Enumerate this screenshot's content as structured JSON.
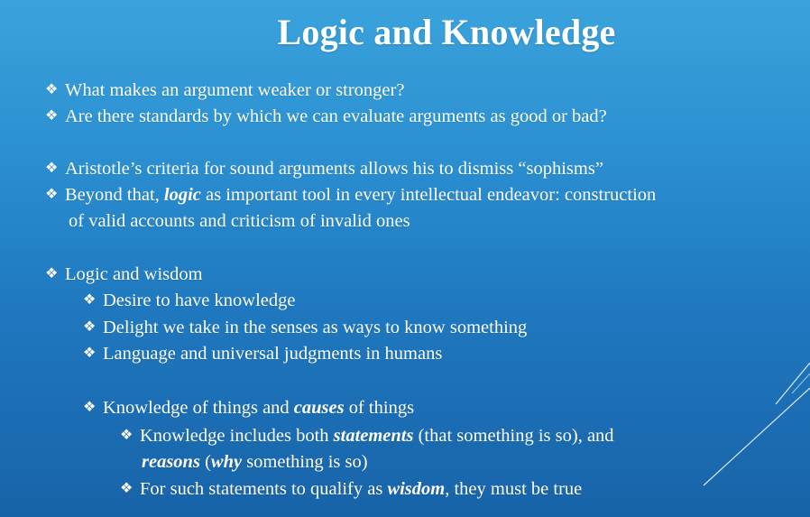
{
  "slide": {
    "title": "Logic and Knowledge",
    "marker": "❖",
    "colors": {
      "background_top": "#3aa3dc",
      "background_bottom": "#1863a8",
      "text": "#ffffff"
    },
    "bullets": {
      "q1": "What makes an argument weaker or stronger?",
      "q2": "Are there standards by which we can evaluate arguments as good or bad?",
      "aristotle": "Aristotle’s criteria for sound arguments allows his to dismiss “sophisms”",
      "beyond_pre": "Beyond that, ",
      "beyond_em": "logic",
      "beyond_post": " as important tool in every intellectual endeavor: construction",
      "beyond_cont": "of valid accounts and criticism of invalid ones",
      "logic_wisdom": "Logic and wisdom",
      "desire": "Desire to have knowledge",
      "delight": "Delight we take in the senses as ways to know something",
      "language": "Language and universal judgments in humans",
      "knowledge_pre": "Knowledge of things and ",
      "knowledge_em": "causes",
      "knowledge_post": " of things",
      "includes_pre": "Knowledge includes both ",
      "includes_em": "statements",
      "includes_post": " (that something is so), and",
      "reasons_em": "reasons",
      "reasons_mid": " (",
      "reasons_why": "why",
      "reasons_post": " something is so)",
      "qualify_pre": "For such statements to qualify as ",
      "qualify_em": "wisdom",
      "qualify_post": ", they must be true"
    }
  }
}
